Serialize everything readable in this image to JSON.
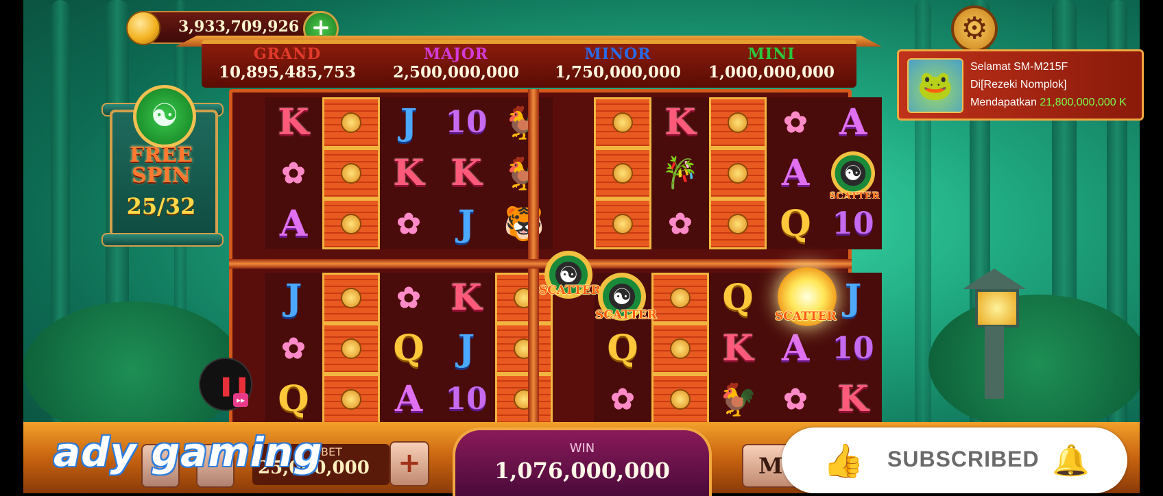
{
  "balance": {
    "amount": "3,933,709,926",
    "icon": "coin-icon"
  },
  "jackpots": [
    {
      "label": "GRAND",
      "value": "10,895,485,753",
      "color": "#e23a2a"
    },
    {
      "label": "MAJOR",
      "value": "2,500,000,000",
      "color": "#d43ad8"
    },
    {
      "label": "MINOR",
      "value": "1,750,000,000",
      "color": "#2a6ae8"
    },
    {
      "label": "MINI",
      "value": "1,000,000,000",
      "color": "#2ac83a"
    }
  ],
  "free_spin": {
    "title": "FREE SPIN",
    "count": "25/32"
  },
  "notification": {
    "line1": "Selamat SM-M215F",
    "line2": "Di[Rezeki Nomplok]",
    "line3_prefix": "Mendapatkan",
    "line3_amount": "21,800,000,000",
    "line3_suffix": "K"
  },
  "reels": {
    "top_left": [
      [
        "K",
        "wild",
        "J",
        "10",
        "rooster"
      ],
      [
        "lotus",
        "wild",
        "K",
        "K",
        "rooster"
      ],
      [
        "A",
        "wild",
        "lotus",
        "J",
        "tiger"
      ]
    ],
    "top_right": [
      [
        "wild",
        "K",
        "wild",
        "lotus",
        "A"
      ],
      [
        "wild",
        "bamboo",
        "wild",
        "A",
        "scatter"
      ],
      [
        "wild",
        "lotus",
        "wild",
        "Q",
        "10"
      ]
    ],
    "bottom_left": [
      [
        "J",
        "wild",
        "lotus",
        "K",
        "wild"
      ],
      [
        "lotus",
        "wild",
        "Q",
        "J",
        "wild"
      ],
      [
        "Q",
        "wild",
        "A",
        "10",
        "wild"
      ]
    ],
    "bottom_right": [
      [
        "empty",
        "wild",
        "Q",
        "empty",
        "J"
      ],
      [
        "Q",
        "wild",
        "K",
        "A",
        "10"
      ],
      [
        "lotus",
        "wild",
        "rooster",
        "lotus",
        "K"
      ]
    ],
    "scatter_label": "SCATTER"
  },
  "bet": {
    "label": "BET",
    "value": "25,000,000"
  },
  "win": {
    "label": "WIN",
    "value": "1,076,000,000"
  },
  "menu_label": "M",
  "subscribed": {
    "label": "SUBSCRIBED"
  },
  "watermark": "ady gaming",
  "colors": {
    "accent": "#f2a840",
    "frame": "#d35a1c",
    "background": "#1fa77f"
  }
}
